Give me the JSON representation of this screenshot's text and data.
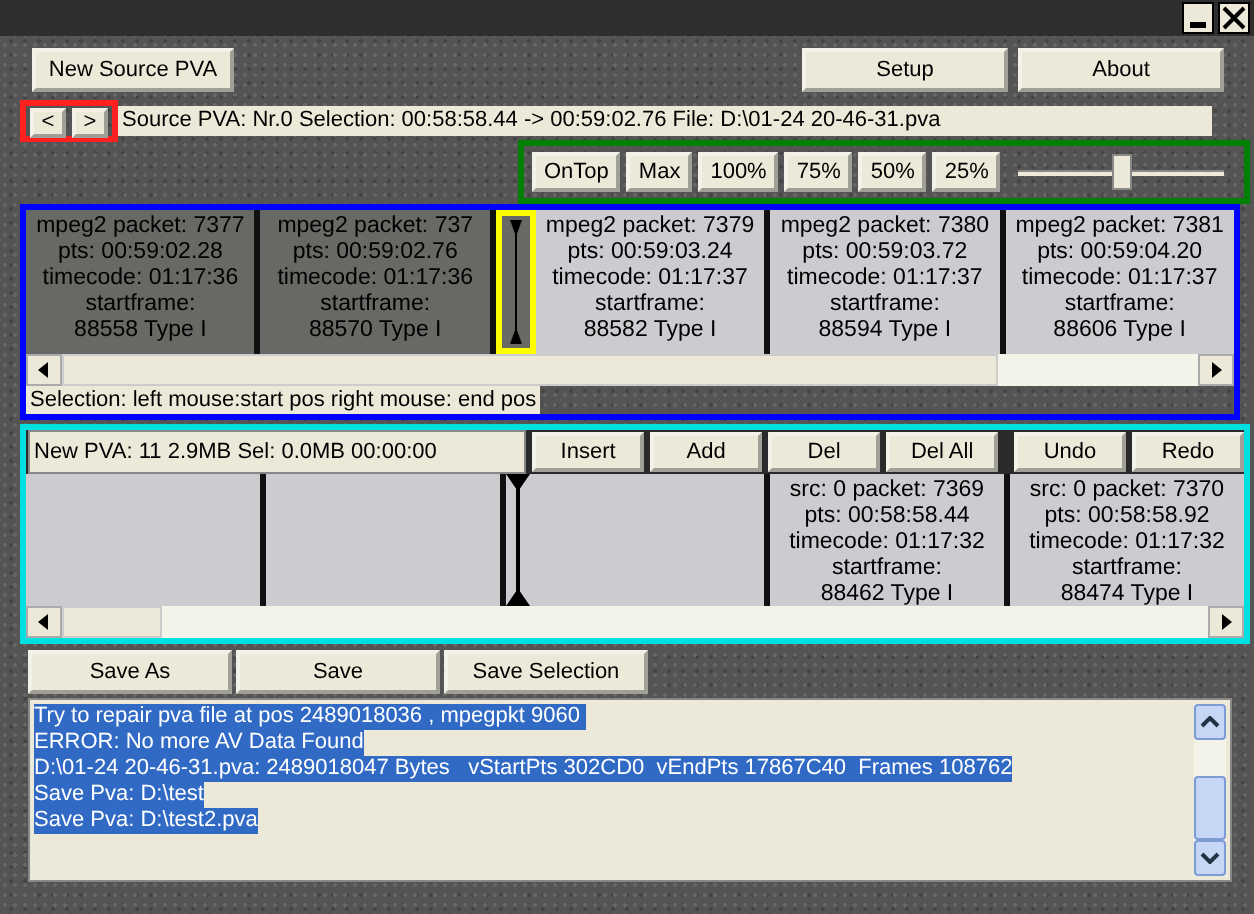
{
  "top_buttons": {
    "left": "New Source PVA",
    "right": [
      "Setup",
      "About"
    ]
  },
  "nav": {
    "buttons": [
      "<",
      ">"
    ],
    "info": "Source PVA:  Nr.0   Selection: 00:58:58.44 -> 00:59:02.76   File: D:\\01-24 20-46-31.pva"
  },
  "zoom_bar": {
    "buttons": [
      "OnTop",
      "Max",
      "100%",
      "75%",
      "50%",
      "25%"
    ],
    "slider": {
      "level": 0.5
    }
  },
  "source_strip": {
    "items": [
      {
        "kind": "frame",
        "selected": true,
        "lines": [
          "mpeg2 packet: 7377",
          "pts: 00:59:02.28",
          "timecode: 01:17:36",
          "startframe:",
          "88558  Type I"
        ]
      },
      {
        "kind": "frame",
        "selected": true,
        "lines": [
          "mpeg2 packet: 737",
          "pts: 00:59:02.76",
          "timecode: 01:17:36",
          "startframe:",
          "88570  Type I"
        ]
      },
      {
        "kind": "cursor",
        "highlighted": true
      },
      {
        "kind": "frame",
        "selected": false,
        "lines": [
          "mpeg2 packet: 7379",
          "pts: 00:59:03.24",
          "timecode: 01:17:37",
          "startframe:",
          "88582  Type I"
        ]
      },
      {
        "kind": "frame",
        "selected": false,
        "lines": [
          "mpeg2 packet: 7380",
          "pts: 00:59:03.72",
          "timecode: 01:17:37",
          "startframe:",
          "88594  Type I"
        ]
      },
      {
        "kind": "frame",
        "selected": false,
        "lines": [
          "mpeg2 packet: 7381",
          "pts: 00:59:04.20",
          "timecode: 01:17:37",
          "startframe:",
          "88606  Type I"
        ]
      }
    ],
    "hint": "Selection: left mouse:start pos  right mouse: end pos"
  },
  "new_strip": {
    "info": "New PVA: 11  2.9MB Sel: 0.0MB 00:00:00",
    "edit_buttons": [
      "Insert",
      "Add",
      "Del",
      "Del All"
    ],
    "history_buttons": [
      "Undo",
      "Redo"
    ],
    "items": [
      {
        "kind": "empty"
      },
      {
        "kind": "empty"
      },
      {
        "kind": "cursor",
        "highlighted": false
      },
      {
        "kind": "empty"
      },
      {
        "kind": "frame",
        "selected": false,
        "lines": [
          "src: 0 packet: 7369",
          "pts: 00:58:58.44",
          "timecode: 01:17:32",
          "startframe:",
          "88462 Type I"
        ]
      },
      {
        "kind": "frame",
        "selected": false,
        "lines": [
          "src: 0 packet: 7370",
          "pts: 00:58:58.92",
          "timecode: 01:17:32",
          "startframe:",
          "88474 Type I"
        ]
      }
    ]
  },
  "save_buttons": [
    "Save As",
    "Save",
    "Save Selection"
  ],
  "log": [
    {
      "text": "Try to repair pva file at pos 2489018036 , mpegpkt 9060 ",
      "selected": true
    },
    {
      "text": "ERROR: No more AV Data Found",
      "selected": true
    },
    {
      "text": "D:\\01-24 20-46-31.pva: 2489018047 Bytes   vStartPts 302CD0  vEndPts 17867C40  Frames 108762",
      "selected": true
    },
    {
      "text": "Save Pva: D:\\test",
      "selected": true
    },
    {
      "text": "Save Pva: D:\\test2.pva",
      "selected": true
    }
  ]
}
